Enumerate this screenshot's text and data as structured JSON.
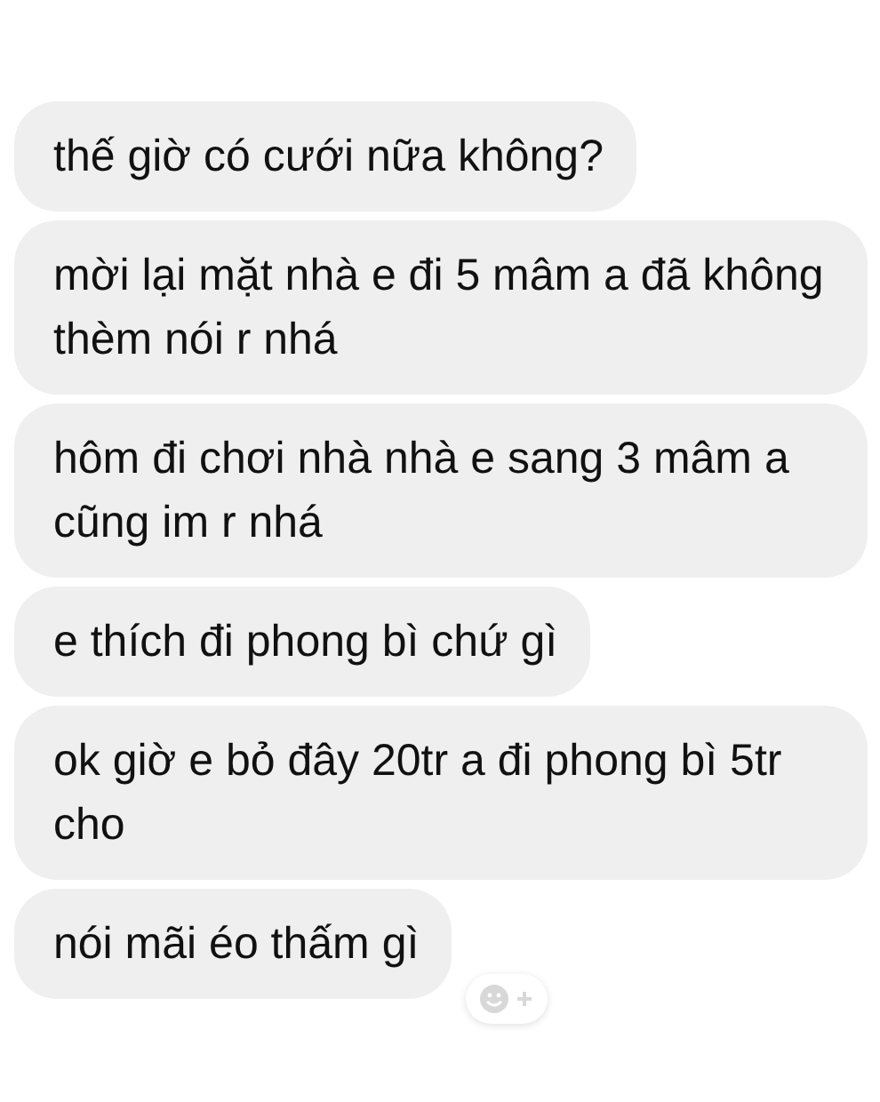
{
  "messages": [
    {
      "text": "thế giờ có cưới nữa không?"
    },
    {
      "text": "mời lại mặt nhà e đi 5 mâm a đã không thèm nói r nhá"
    },
    {
      "text": "hôm đi chơi nhà nhà e sang 3 mâm a cũng im r nhá"
    },
    {
      "text": "e thích đi phong bì chứ gì"
    },
    {
      "text": "ok giờ e bỏ đây 20tr a đi phong bì 5tr cho"
    },
    {
      "text": "nói mãi éo thấm gì"
    }
  ]
}
